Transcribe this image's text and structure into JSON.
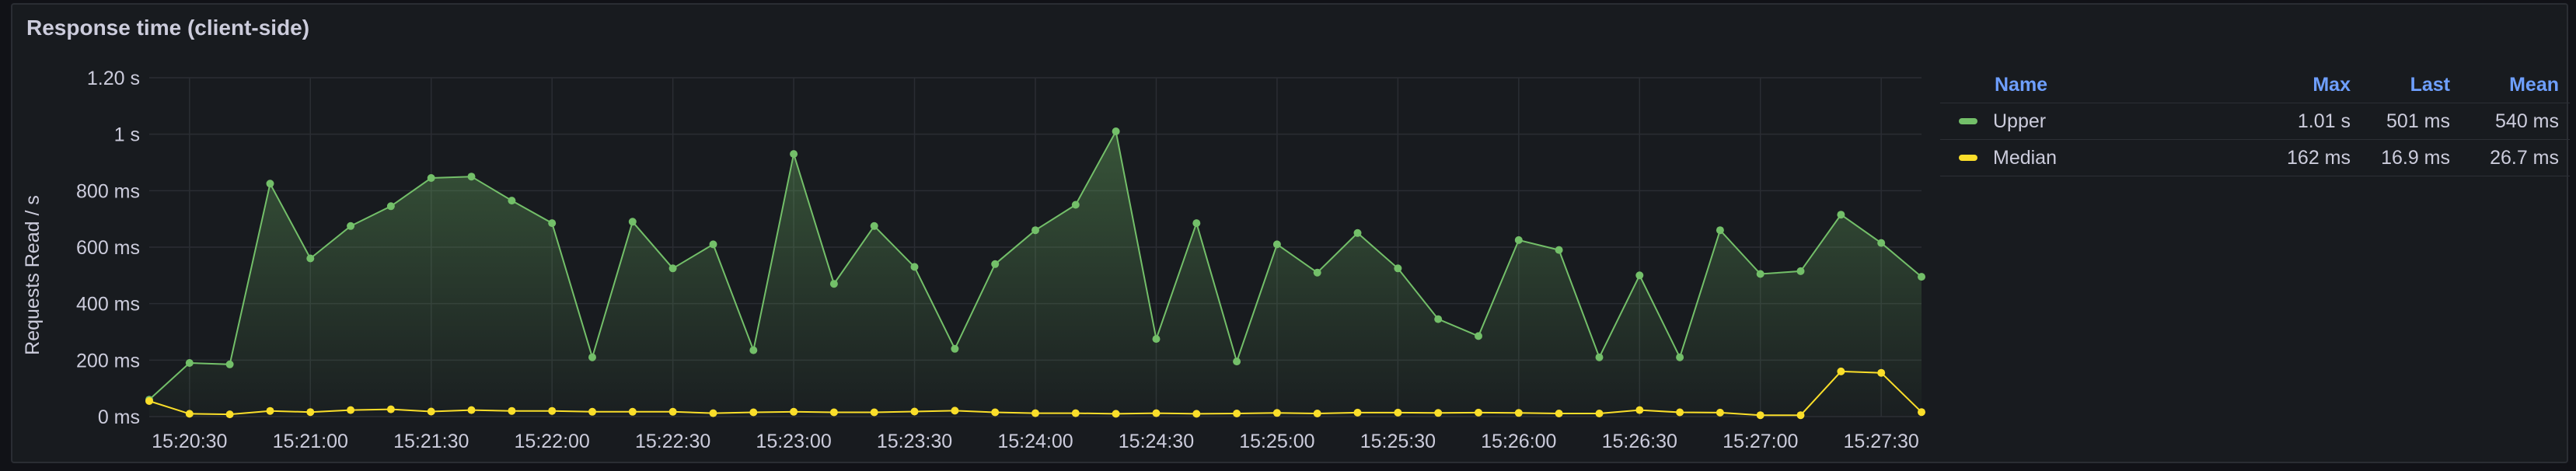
{
  "panel": {
    "title": "Response time (client-side)"
  },
  "legend": {
    "headers": {
      "name": "Name",
      "max": "Max",
      "last": "Last",
      "mean": "Mean"
    },
    "rows": [
      {
        "name": "Upper",
        "max": "1.01 s",
        "last": "501 ms",
        "mean": "540 ms",
        "color": "#73bf69"
      },
      {
        "name": "Median",
        "max": "162 ms",
        "last": "16.9 ms",
        "mean": "26.7 ms",
        "color": "#fade2a"
      }
    ]
  },
  "chart_data": {
    "type": "area",
    "ylabel": "Requests Read / s",
    "y_ticks": [
      "0 ms",
      "200 ms",
      "400 ms",
      "600 ms",
      "800 ms",
      "1 s",
      "1.20 s"
    ],
    "y_tick_values_ms": [
      0,
      200,
      400,
      600,
      800,
      1000,
      1200
    ],
    "ylim_ms": [
      0,
      1200
    ],
    "x_ticks": [
      "15:20:30",
      "15:21:00",
      "15:21:30",
      "15:22:00",
      "15:22:30",
      "15:23:00",
      "15:23:30",
      "15:24:00",
      "15:24:30",
      "15:25:00",
      "15:25:30",
      "15:26:00",
      "15:26:30",
      "15:27:00",
      "15:27:30"
    ],
    "x_range": [
      "15:20:20",
      "15:27:40"
    ],
    "interval_seconds": 10,
    "grid": true,
    "legend_placement": "right",
    "series": [
      {
        "name": "Upper",
        "color": "#73bf69",
        "values_ms": [
          60,
          190,
          185,
          825,
          560,
          675,
          745,
          845,
          850,
          765,
          685,
          210,
          690,
          525,
          610,
          235,
          930,
          470,
          675,
          530,
          240,
          540,
          660,
          750,
          1010,
          275,
          685,
          195,
          610,
          510,
          650,
          525,
          345,
          285,
          625,
          590,
          210,
          500,
          210,
          660,
          505,
          515,
          715,
          615,
          495
        ]
      },
      {
        "name": "Median",
        "color": "#fade2a",
        "values_ms": [
          55,
          10,
          8,
          20,
          16,
          23,
          26,
          18,
          23,
          20,
          20,
          17,
          17,
          17,
          12,
          15,
          17,
          15,
          15,
          18,
          21,
          15,
          12,
          12,
          10,
          12,
          10,
          11,
          13,
          11,
          14,
          14,
          13,
          14,
          13,
          11,
          11,
          23,
          15,
          14,
          5,
          5,
          160,
          155,
          16
        ]
      }
    ]
  }
}
